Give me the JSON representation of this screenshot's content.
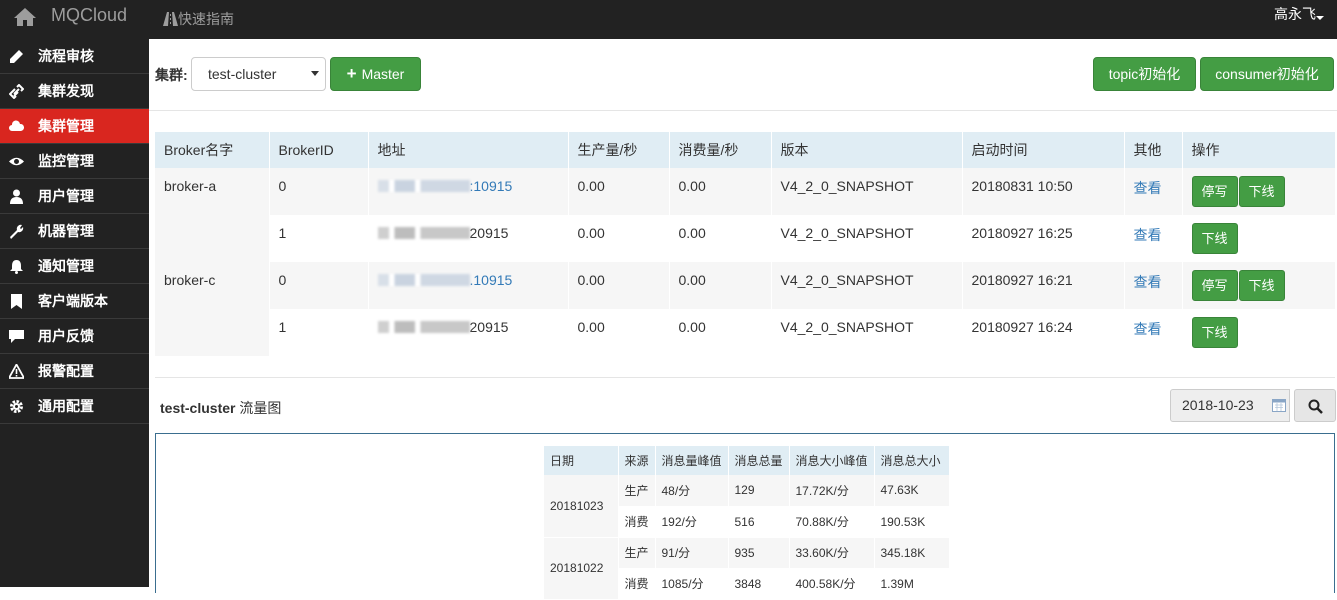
{
  "topbar": {
    "brand": "MQCloud",
    "guide": "快速指南",
    "user": "高永飞"
  },
  "sidebar": {
    "items": [
      {
        "label": "流程审核",
        "icon": "pencil-icon"
      },
      {
        "label": "集群发现",
        "icon": "link-icon"
      },
      {
        "label": "集群管理",
        "icon": "cloud-icon",
        "active": true
      },
      {
        "label": "监控管理",
        "icon": "eye-icon"
      },
      {
        "label": "用户管理",
        "icon": "user-icon"
      },
      {
        "label": "机器管理",
        "icon": "wrench-icon"
      },
      {
        "label": "通知管理",
        "icon": "bell-icon"
      },
      {
        "label": "客户端版本",
        "icon": "bookmark-icon"
      },
      {
        "label": "用户反馈",
        "icon": "comment-icon"
      },
      {
        "label": "报警配置",
        "icon": "warning-icon"
      },
      {
        "label": "通用配置",
        "icon": "gear-icon"
      }
    ]
  },
  "toolbar": {
    "cluster_label": "集群:",
    "cluster_value": "test-cluster",
    "master_button": "Master",
    "topic_init_button": "topic初始化",
    "consumer_init_button": "consumer初始化"
  },
  "broker_table": {
    "headers": [
      "Broker名字",
      "BrokerID",
      "地址",
      "生产量/秒",
      "消费量/秒",
      "版本",
      "启动时间",
      "其他",
      "操作"
    ],
    "groups": [
      {
        "name": "broker-a",
        "rows": [
          {
            "id": "0",
            "addr_suffix": ":10915",
            "addr_link": true,
            "produce": "0.00",
            "consume": "0.00",
            "version": "V4_2_0_SNAPSHOT",
            "start": "20180831 10:50",
            "other": "查看",
            "stop_write": "停写",
            "offline": "下线"
          },
          {
            "id": "1",
            "addr_suffix": "20915",
            "addr_link": false,
            "produce": "0.00",
            "consume": "0.00",
            "version": "V4_2_0_SNAPSHOT",
            "start": "20180927 16:25",
            "other": "查看",
            "offline": "下线"
          }
        ]
      },
      {
        "name": "broker-c",
        "rows": [
          {
            "id": "0",
            "addr_suffix": ".10915",
            "addr_link": true,
            "produce": "0.00",
            "consume": "0.00",
            "version": "V4_2_0_SNAPSHOT",
            "start": "20180927 16:21",
            "other": "查看",
            "stop_write": "停写",
            "offline": "下线"
          },
          {
            "id": "1",
            "addr_suffix": "20915",
            "addr_link": false,
            "produce": "0.00",
            "consume": "0.00",
            "version": "V4_2_0_SNAPSHOT",
            "start": "20180927 16:24",
            "other": "查看",
            "offline": "下线"
          }
        ]
      }
    ]
  },
  "flow": {
    "cluster": "test-cluster",
    "title_suffix": " 流量图",
    "date": "2018-10-23"
  },
  "flow_table": {
    "headers": [
      "日期",
      "来源",
      "消息量峰值",
      "消息总量",
      "消息大小峰值",
      "消息总大小"
    ],
    "groups": [
      {
        "date": "20181023",
        "rows": [
          {
            "source": "生产",
            "peak": "48/分",
            "total": "129",
            "size_peak": "17.72K/分",
            "size_total": "47.63K"
          },
          {
            "source": "消费",
            "peak": "192/分",
            "total": "516",
            "size_peak": "70.88K/分",
            "size_total": "190.53K"
          }
        ]
      },
      {
        "date": "20181022",
        "rows": [
          {
            "source": "生产",
            "peak": "91/分",
            "total": "935",
            "size_peak": "33.60K/分",
            "size_total": "345.18K"
          },
          {
            "source": "消费",
            "peak": "1085/分",
            "total": "3848",
            "size_peak": "400.58K/分",
            "size_total": "1.39M"
          }
        ]
      }
    ]
  }
}
